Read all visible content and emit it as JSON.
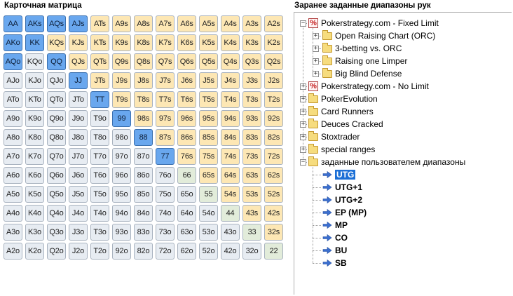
{
  "matrix": {
    "title": "Карточная матрица",
    "rows": [
      [
        "AA",
        "AKs",
        "AQs",
        "AJs",
        "ATs",
        "A9s",
        "A8s",
        "A7s",
        "A6s",
        "A5s",
        "A4s",
        "A3s",
        "A2s"
      ],
      [
        "AKo",
        "KK",
        "KQs",
        "KJs",
        "KTs",
        "K9s",
        "K8s",
        "K7s",
        "K6s",
        "K5s",
        "K4s",
        "K3s",
        "K2s"
      ],
      [
        "AQo",
        "KQo",
        "QQ",
        "QJs",
        "QTs",
        "Q9s",
        "Q8s",
        "Q7s",
        "Q6s",
        "Q5s",
        "Q4s",
        "Q3s",
        "Q2s"
      ],
      [
        "AJo",
        "KJo",
        "QJo",
        "JJ",
        "JTs",
        "J9s",
        "J8s",
        "J7s",
        "J6s",
        "J5s",
        "J4s",
        "J3s",
        "J2s"
      ],
      [
        "ATo",
        "KTo",
        "QTo",
        "JTo",
        "TT",
        "T9s",
        "T8s",
        "T7s",
        "T6s",
        "T5s",
        "T4s",
        "T3s",
        "T2s"
      ],
      [
        "A9o",
        "K9o",
        "Q9o",
        "J9o",
        "T9o",
        "99",
        "98s",
        "97s",
        "96s",
        "95s",
        "94s",
        "93s",
        "92s"
      ],
      [
        "A8o",
        "K8o",
        "Q8o",
        "J8o",
        "T8o",
        "98o",
        "88",
        "87s",
        "86s",
        "85s",
        "84s",
        "83s",
        "82s"
      ],
      [
        "A7o",
        "K7o",
        "Q7o",
        "J7o",
        "T7o",
        "97o",
        "87o",
        "77",
        "76s",
        "75s",
        "74s",
        "73s",
        "72s"
      ],
      [
        "A6o",
        "K6o",
        "Q6o",
        "J6o",
        "T6o",
        "96o",
        "86o",
        "76o",
        "66",
        "65s",
        "64s",
        "63s",
        "62s"
      ],
      [
        "A5o",
        "K5o",
        "Q5o",
        "J5o",
        "T5o",
        "95o",
        "85o",
        "75o",
        "65o",
        "55",
        "54s",
        "53s",
        "52s"
      ],
      [
        "A4o",
        "K4o",
        "Q4o",
        "J4o",
        "T4o",
        "94o",
        "84o",
        "74o",
        "64o",
        "54o",
        "44",
        "43s",
        "42s"
      ],
      [
        "A3o",
        "K3o",
        "Q3o",
        "J3o",
        "T3o",
        "93o",
        "83o",
        "73o",
        "63o",
        "53o",
        "43o",
        "33",
        "32s"
      ],
      [
        "A2o",
        "K2o",
        "Q2o",
        "J2o",
        "T2o",
        "92o",
        "82o",
        "72o",
        "62o",
        "52o",
        "42o",
        "32o",
        "22"
      ]
    ],
    "selected": [
      "AA",
      "AKs",
      "AQs",
      "AJs",
      "AKo",
      "KK",
      "AQo",
      "QQ",
      "JJ",
      "TT",
      "99",
      "88",
      "77"
    ],
    "colors": {
      "selected": "#69a7ee",
      "suited": "#fde7b4",
      "offsuit": "#e7ecf2",
      "pair": "#e2ecda"
    }
  },
  "tree": {
    "title": "Заранее заданные диапазоны рук",
    "nodes": [
      {
        "label": "Pokerstrategy.com - Fixed Limit",
        "icon": "pokerstrategy-icon",
        "level": 0,
        "expander": "−"
      },
      {
        "label": "Open Raising Chart (ORC)",
        "icon": "folder-icon",
        "level": 1,
        "expander": "+"
      },
      {
        "label": "3-betting vs. ORC",
        "icon": "folder-icon",
        "level": 1,
        "expander": "+"
      },
      {
        "label": "Raising one Limper",
        "icon": "folder-icon",
        "level": 1,
        "expander": "+"
      },
      {
        "label": "Big Blind Defense",
        "icon": "folder-icon",
        "level": 1,
        "expander": "+"
      },
      {
        "label": "Pokerstrategy.com - No Limit",
        "icon": "pokerstrategy-icon",
        "level": 0,
        "expander": "+"
      },
      {
        "label": "PokerEvolution",
        "icon": "folder-icon",
        "level": 0,
        "expander": "+"
      },
      {
        "label": "Card Runners",
        "icon": "folder-icon",
        "level": 0,
        "expander": "+"
      },
      {
        "label": "Deuces Cracked",
        "icon": "folder-icon",
        "level": 0,
        "expander": "+"
      },
      {
        "label": "Stoxtrader",
        "icon": "folder-icon",
        "level": 0,
        "expander": "+"
      },
      {
        "label": "special ranges",
        "icon": "folder-icon",
        "level": 0,
        "expander": "+"
      },
      {
        "label": "заданные пользователем диапазоны",
        "icon": "user-folder-icon",
        "level": 0,
        "expander": "−"
      },
      {
        "label": "UTG",
        "icon": "arrow-right-icon",
        "level": 1,
        "selected": true
      },
      {
        "label": "UTG+1",
        "icon": "arrow-right-icon",
        "level": 1
      },
      {
        "label": "UTG+2",
        "icon": "arrow-right-icon",
        "level": 1
      },
      {
        "label": "EP (MP)",
        "icon": "arrow-right-icon",
        "level": 1
      },
      {
        "label": "MP",
        "icon": "arrow-right-icon",
        "level": 1
      },
      {
        "label": "CO",
        "icon": "arrow-right-icon",
        "level": 1
      },
      {
        "label": "BU",
        "icon": "arrow-right-icon",
        "level": 1
      },
      {
        "label": "SB",
        "icon": "arrow-right-icon",
        "level": 1
      }
    ]
  }
}
